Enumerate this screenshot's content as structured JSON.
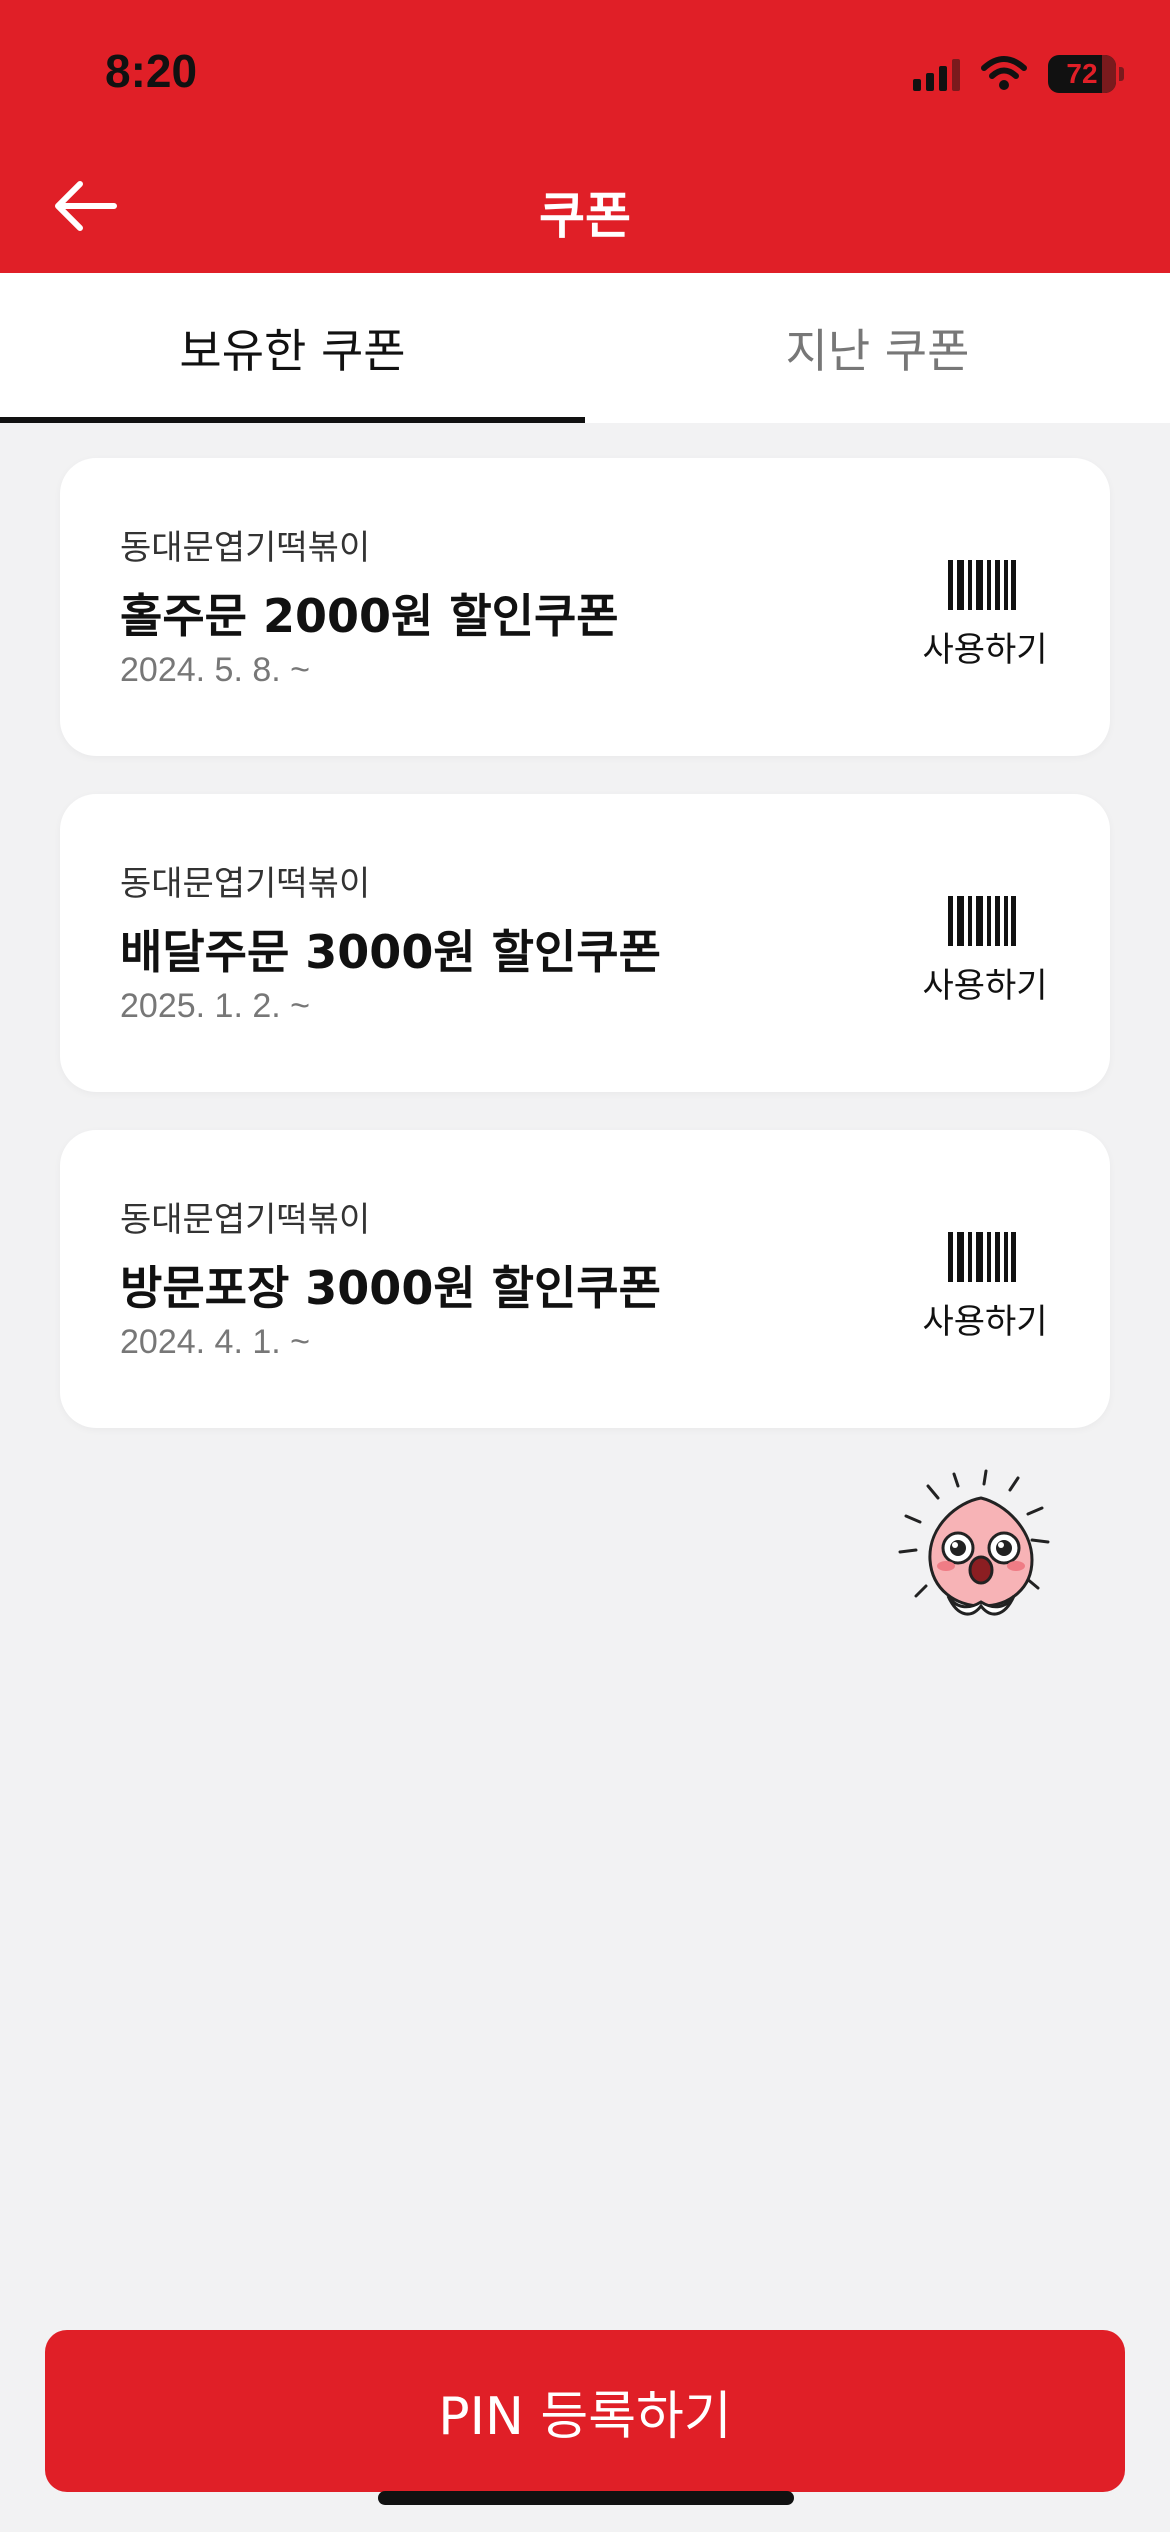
{
  "status_bar": {
    "time": "8:20",
    "battery": "72"
  },
  "header": {
    "title": "쿠폰",
    "back_icon": "arrow-left-icon"
  },
  "tabs": [
    {
      "label": "보유한 쿠폰",
      "active": true
    },
    {
      "label": "지난 쿠폰",
      "active": false
    }
  ],
  "coupons": [
    {
      "store": "동대문엽기떡볶이",
      "title": "홀주문 2000원 할인쿠폰",
      "date": "2024. 5. 8. ~",
      "action_label": "사용하기",
      "action_icon": "barcode-icon"
    },
    {
      "store": "동대문엽기떡볶이",
      "title": "배달주문 3000원 할인쿠폰",
      "date": "2025. 1. 2. ~",
      "action_label": "사용하기",
      "action_icon": "barcode-icon"
    },
    {
      "store": "동대문엽기떡볶이",
      "title": "방문포장 3000원 할인쿠폰",
      "date": "2024. 4. 1. ~",
      "action_label": "사용하기",
      "action_icon": "barcode-icon"
    }
  ],
  "footer": {
    "pin_button_label": "PIN 등록하기"
  },
  "colors": {
    "brand_red": "#e01f27",
    "background": "#f2f2f3",
    "card": "#ffffff"
  }
}
